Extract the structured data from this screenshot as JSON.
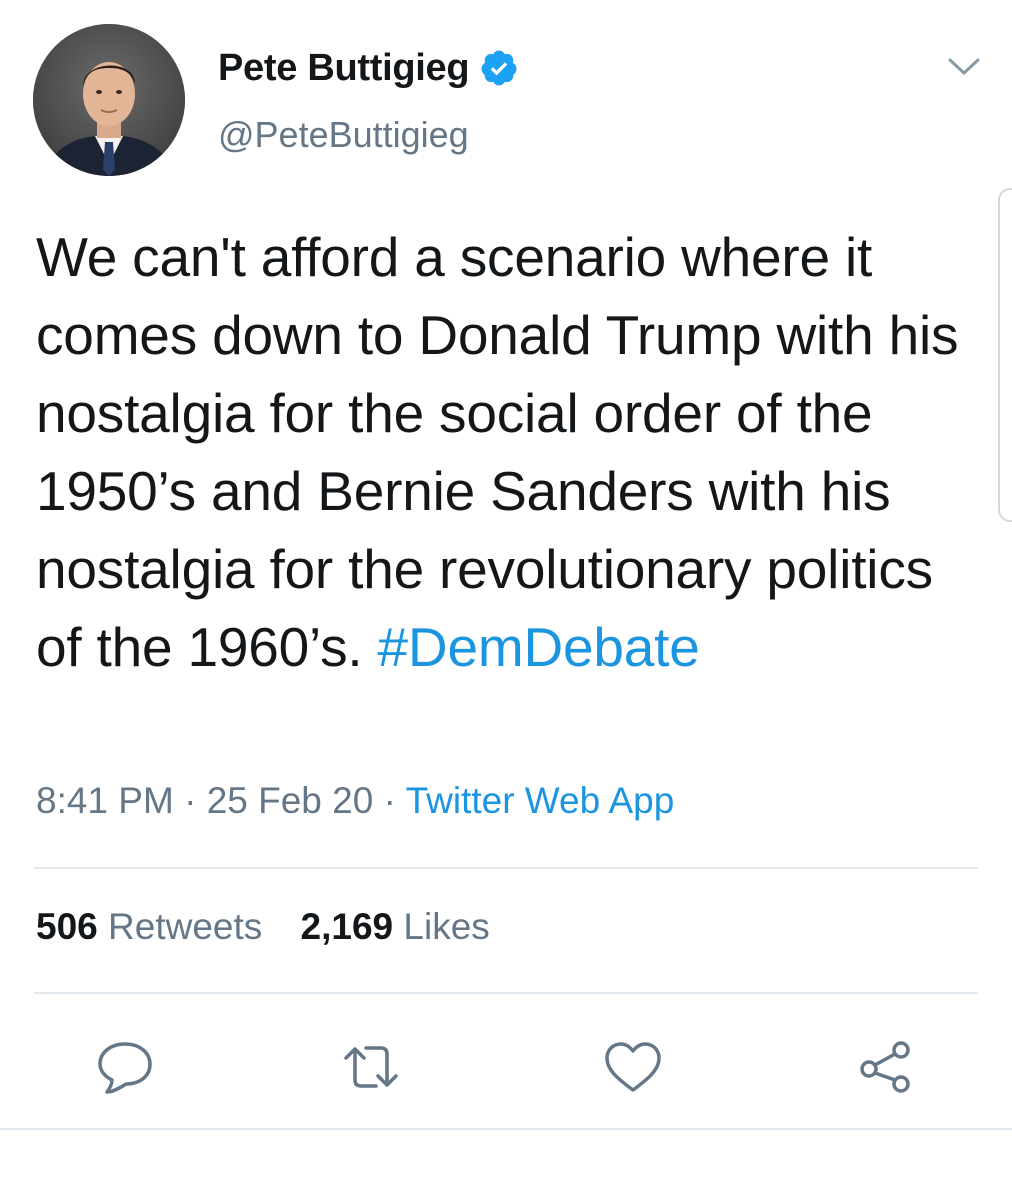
{
  "author": {
    "name": "Pete Buttigieg",
    "handle": "@PeteButtigieg",
    "verified": true
  },
  "tweet": {
    "text": "We can't afford a scenario where it comes down to Donald Trump with his nostalgia for the social order of the 1950’s and Bernie Sanders with his nostalgia for the revolutionary politics of the 1960’s.",
    "hashtag": "#DemDebate",
    "time": "8:41 PM",
    "separator": "·",
    "date": "25 Feb 20",
    "source": "Twitter Web App"
  },
  "stats": {
    "retweets_count": "506",
    "retweets_label": "Retweets",
    "likes_count": "2,169",
    "likes_label": "Likes"
  },
  "icons": {
    "menu": "chevron-down-icon",
    "reply": "reply-icon",
    "retweet": "retweet-icon",
    "like": "heart-icon",
    "share": "share-icon"
  },
  "colors": {
    "link": "#1b95e0",
    "muted": "#657786",
    "text": "#14171a",
    "divider": "#e1e8ed",
    "verified": "#1da1f2"
  }
}
